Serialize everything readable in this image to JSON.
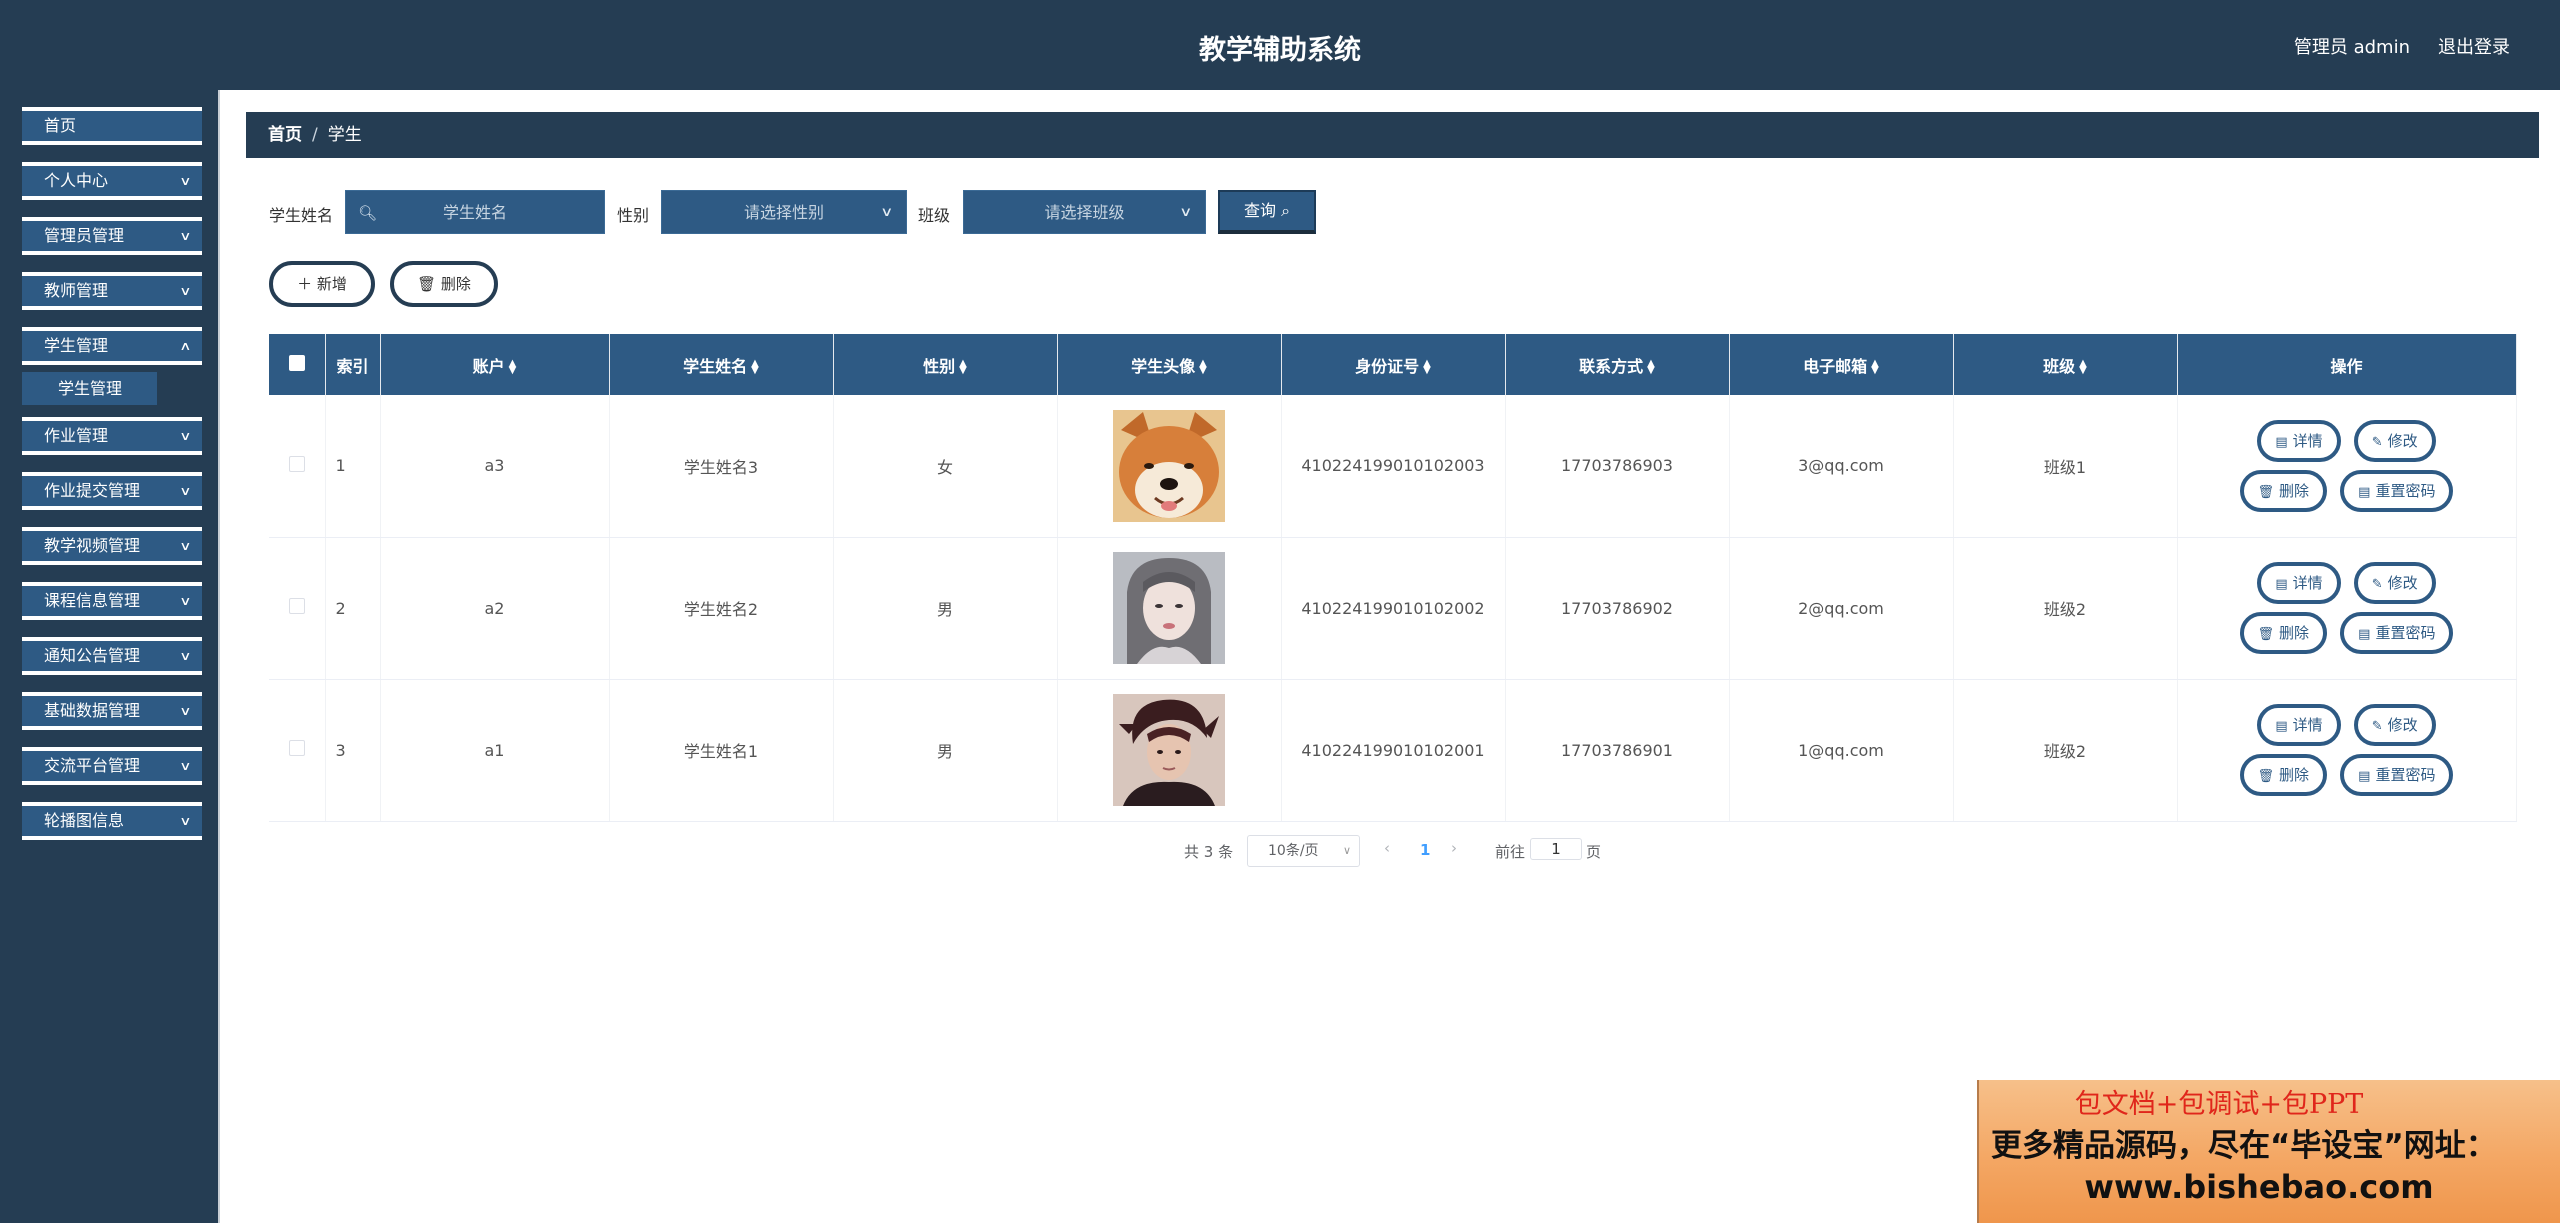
{
  "header": {
    "title": "教学辅助系统",
    "admin_label": "管理员 admin",
    "logout_label": "退出登录"
  },
  "sidebar": {
    "items": [
      {
        "label": "首页"
      },
      {
        "label": "个人中心"
      },
      {
        "label": "管理员管理"
      },
      {
        "label": "教师管理"
      },
      {
        "label": "学生管理"
      },
      {
        "label": "作业管理"
      },
      {
        "label": "作业提交管理"
      },
      {
        "label": "教学视频管理"
      },
      {
        "label": "课程信息管理"
      },
      {
        "label": "通知公告管理"
      },
      {
        "label": "基础数据管理"
      },
      {
        "label": "交流平台管理"
      },
      {
        "label": "轮播图信息"
      }
    ],
    "sub_item": "学生管理"
  },
  "breadcrumb": {
    "home": "首页",
    "separator": "/",
    "current": "学生"
  },
  "search": {
    "name_label": "学生姓名",
    "name_placeholder": "学生姓名",
    "gender_label": "性别",
    "gender_placeholder": "请选择性别",
    "class_label": "班级",
    "class_placeholder": "请选择班级",
    "query_label": "查询"
  },
  "actions": {
    "add_label": "新增",
    "delete_label": "删除"
  },
  "table": {
    "columns": [
      "索引",
      "账户",
      "学生姓名",
      "性别",
      "学生头像",
      "身份证号",
      "联系方式",
      "电子邮箱",
      "班级",
      "操作"
    ],
    "rows": [
      {
        "index": "1",
        "account": "a3",
        "name": "学生姓名3",
        "gender": "女",
        "avatar": "shiba-dog-photo",
        "id_card": "410224199010102003",
        "phone": "17703786903",
        "email": "3@qq.com",
        "class": "班级1"
      },
      {
        "index": "2",
        "account": "a2",
        "name": "学生姓名2",
        "gender": "男",
        "avatar": "girl-portrait-photo",
        "id_card": "410224199010102002",
        "phone": "17703786902",
        "email": "2@qq.com",
        "class": "班级2"
      },
      {
        "index": "3",
        "account": "a1",
        "name": "学生姓名1",
        "gender": "男",
        "avatar": "boy-portrait-photo",
        "id_card": "410224199010102001",
        "phone": "17703786901",
        "email": "1@qq.com",
        "class": "班级2"
      }
    ],
    "row_actions": {
      "detail": "详情",
      "edit": "修改",
      "delete": "删除",
      "reset": "重置密码"
    }
  },
  "pagination": {
    "total": "共 3 条",
    "page_size": "10条/页",
    "current_page": "1",
    "goto_label": "前往",
    "goto_value": "1",
    "page_suffix": "页"
  },
  "banner": {
    "line1": "包文档+包调试+包PPT",
    "line2": "更多精品源码，尽在“毕设宝”网址：",
    "line3": "www.bishebao.com"
  },
  "colors": {
    "header_bg": "#253d53",
    "accent": "#2e5a84",
    "pager_active": "#409eff"
  }
}
